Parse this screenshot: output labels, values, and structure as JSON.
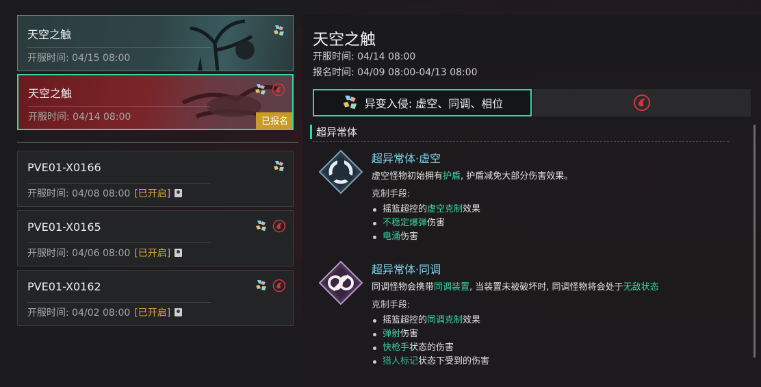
{
  "events": [
    {
      "title": "天空之触",
      "time_label": "开服时间:",
      "time": "04/15 08:00",
      "icons": [
        "mutation-icon"
      ]
    },
    {
      "title": "天空之触",
      "time_label": "开服时间:",
      "time": "04/14 08:00",
      "icons": [
        "mutation-icon",
        "crimson-sigil-icon"
      ],
      "tag": "已报名"
    },
    {
      "title": "PVE01-X0166",
      "time_label": "开服时间:",
      "time": "04/08 08:00",
      "status": "[已开启]",
      "icons": [
        "mutation-icon"
      ]
    },
    {
      "title": "PVE01-X0165",
      "time_label": "开服时间:",
      "time": "04/06 08:00",
      "status": "[已开启]",
      "icons": [
        "mutation-icon",
        "crimson-sigil-icon"
      ]
    },
    {
      "title": "PVE01-X0162",
      "time_label": "开服时间:",
      "time": "04/02 08:00",
      "status": "[已开启]",
      "icons": [
        "mutation-icon",
        "crimson-sigil-icon"
      ]
    }
  ],
  "detail": {
    "title": "天空之触",
    "open_time": "开服时间: 04/14 08:00",
    "register_time": "报名时间: 04/09 08:00-04/13 08:00",
    "tab_mutation": "异变入侵: 虚空、同调、相位",
    "section": "超异常体",
    "entries": [
      {
        "name": "超异常体·虚空",
        "desc_a": "虚空怪物初始拥有",
        "desc_b": "护盾",
        "desc_c": ", 护盾减免大部分伤害效果。",
        "counter_label": "克制手段:",
        "items": [
          {
            "a": "摇篮超控的",
            "b": "虚空克制",
            "c": "效果"
          },
          {
            "a": "",
            "b": "不稳定爆弹",
            "c": "伤害"
          },
          {
            "a": "",
            "b": "电涌",
            "c": "伤害"
          }
        ]
      },
      {
        "name": "超异常体·同调",
        "desc_a": "同调怪物会携带",
        "desc_b": "同调装置",
        "desc_c": ", 当装置未被破坏时, 同调怪物将会处于",
        "desc_d": "无敌状态",
        "counter_label": "克制手段:",
        "items": [
          {
            "a": "摇篮超控的",
            "b": "同调克制",
            "c": "效果"
          },
          {
            "a": "",
            "b": "弹射",
            "c": "伤害"
          },
          {
            "a": "",
            "b": "快枪手",
            "c": "状态的伤害"
          },
          {
            "a": "",
            "b": "猎人标记",
            "c": "状态下受到的伤害"
          }
        ]
      }
    ]
  },
  "colors": {
    "accent": "#37d7a3",
    "highlight_blue": "#7fd4ea",
    "registered_tag": "#c99a24",
    "opened_status": "#d9a63a"
  }
}
